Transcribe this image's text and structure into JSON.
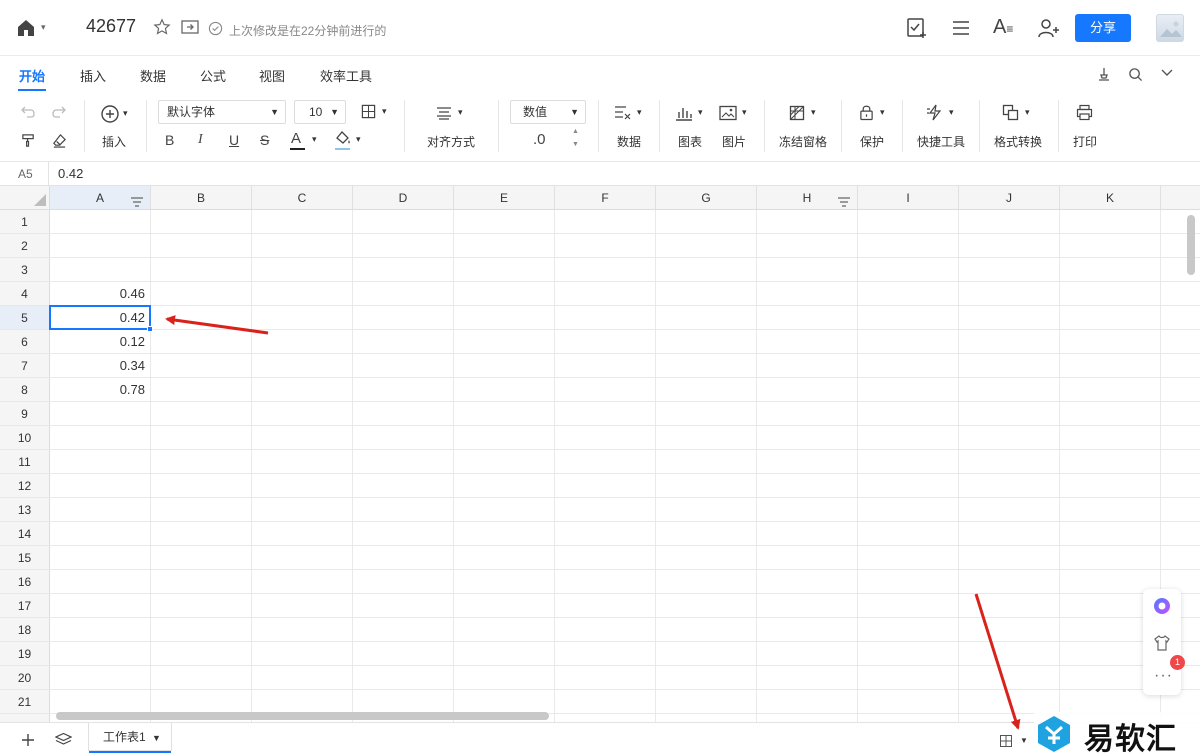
{
  "header": {
    "doc_title": "42677",
    "save_status": "上次修改是在22分钟前进行的",
    "share_label": "分享"
  },
  "tabs": [
    {
      "label": "开始",
      "active": true
    },
    {
      "label": "插入"
    },
    {
      "label": "数据"
    },
    {
      "label": "公式"
    },
    {
      "label": "视图"
    },
    {
      "label": "效率工具"
    }
  ],
  "toolbar": {
    "insert_label": "插入",
    "font_family": "默认字体",
    "font_size": "10",
    "align_label": "对齐方式",
    "number_format": "数值",
    "decimal_label": ".0",
    "data_label": "数据",
    "chart_label": "图表",
    "image_label": "图片",
    "freeze_label": "冻结窗格",
    "protect_label": "保护",
    "quick_tools_label": "快捷工具",
    "format_convert_label": "格式转换",
    "print_label": "打印",
    "bold": "B",
    "italic": "I",
    "underline": "U",
    "strike": "S",
    "font_color": "A"
  },
  "formula_bar": {
    "cell_ref": "A5",
    "value": "0.42"
  },
  "grid": {
    "columns": [
      "A",
      "B",
      "C",
      "D",
      "E",
      "F",
      "G",
      "H",
      "I",
      "J",
      "K"
    ],
    "rows": [
      "1",
      "2",
      "3",
      "4",
      "5",
      "6",
      "7",
      "8",
      "9",
      "10",
      "11",
      "12",
      "13",
      "14",
      "15",
      "16",
      "17",
      "18",
      "19",
      "20",
      "21"
    ],
    "cells": {
      "A4": "0.46",
      "A5": "0.42",
      "A6": "0.12",
      "A7": "0.34",
      "A8": "0.78"
    },
    "selected_cell": "A5"
  },
  "bottom": {
    "sheet_tab": "工作表1",
    "notification_count": "1",
    "watermark_text": "易软汇"
  },
  "colors": {
    "accent": "#1677ff",
    "arrow": "#d9221b",
    "badge": "#f04848"
  }
}
